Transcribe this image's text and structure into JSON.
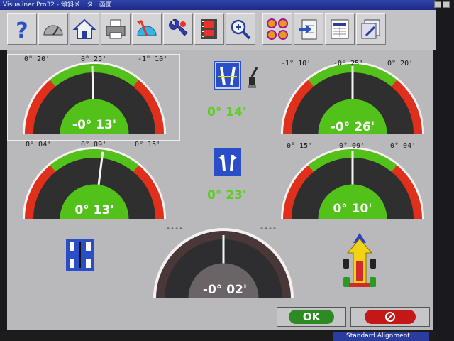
{
  "window": {
    "title": "Visualiner Pro32 - 傾斜メーター画面"
  },
  "toolbar": {
    "buttons": [
      {
        "name": "help-button",
        "icon": "question-icon"
      },
      {
        "name": "meter-button",
        "icon": "gauge-icon"
      },
      {
        "name": "home-button",
        "icon": "house-icon"
      },
      {
        "name": "print-button",
        "icon": "printer-icon"
      },
      {
        "name": "protractor-button",
        "icon": "protractor-icon"
      },
      {
        "name": "adjust-button",
        "icon": "wrench-icon"
      },
      {
        "name": "video-button",
        "icon": "film-icon"
      },
      {
        "name": "zoom-button",
        "icon": "magnifier-icon"
      },
      {
        "name": "wheels-button",
        "icon": "wheels-icon"
      },
      {
        "name": "export-button",
        "icon": "clipboard-arrow-icon"
      },
      {
        "name": "report-button",
        "icon": "report-icon"
      },
      {
        "name": "settings-button",
        "icon": "settings-icon"
      }
    ]
  },
  "gauges": {
    "front_left_camber": {
      "min": "0° 20'",
      "target": "0° 25'",
      "max": "-1° 10'",
      "value": "-0° 13'",
      "needle_level": 0.49
    },
    "front_right_camber": {
      "min": "-1° 10'",
      "target": "-0° 25'",
      "max": "0° 20'",
      "value": "-0° 26'",
      "needle_level": 0.5
    },
    "rear_left_camber": {
      "min": "0° 04'",
      "target": "0° 09'",
      "max": "0° 15'",
      "value": "0° 13'",
      "needle_level": 0.54
    },
    "rear_right_camber": {
      "min": "0° 15'",
      "target": "0° 09'",
      "max": "0° 04'",
      "value": "0° 10'",
      "needle_level": 0.5
    },
    "thrust_angle": {
      "min": "----",
      "max": "----",
      "value": "-0° 02'",
      "needle_level": 0.5
    }
  },
  "center": {
    "front_value": "0° 14'",
    "rear_value": "0° 23'"
  },
  "footer": {
    "ok_label": "OK",
    "mode_label": "Standard Alignment"
  },
  "colors": {
    "gauge_red": "#e0301c",
    "gauge_green": "#52c21a",
    "center_value": "#57d01e"
  }
}
